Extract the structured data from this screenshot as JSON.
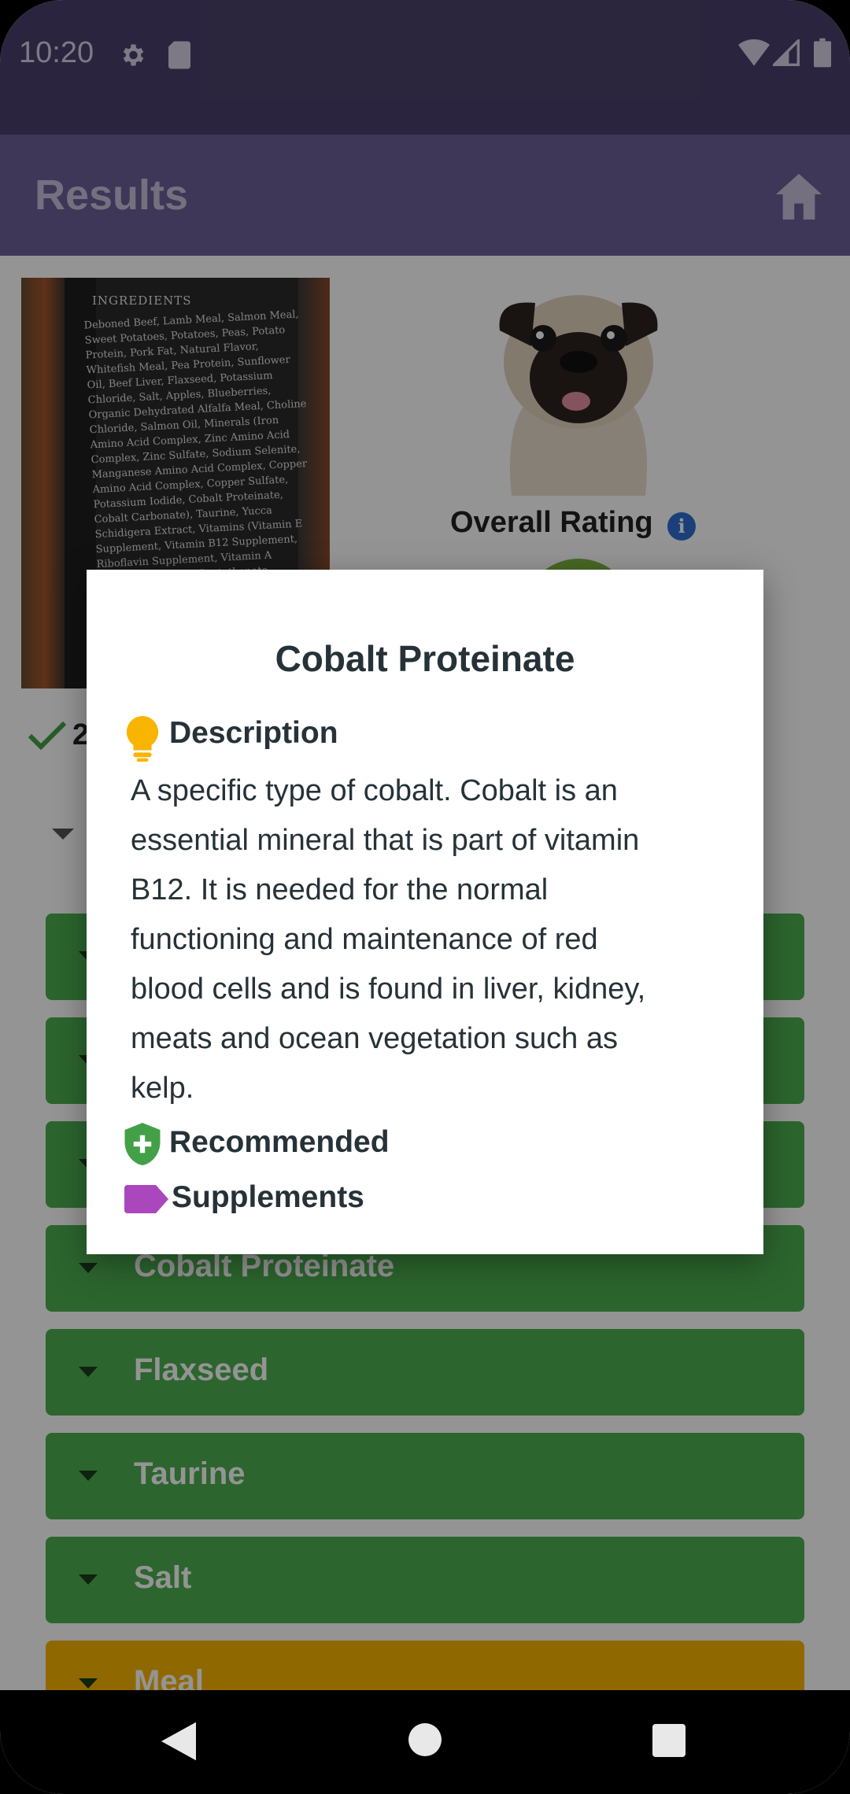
{
  "status_bar": {
    "time": "10:20",
    "icons": [
      "gear-icon",
      "sd-card-icon",
      "wifi-icon",
      "signal-icon",
      "battery-icon"
    ]
  },
  "app_bar": {
    "title": "Results",
    "home_icon": "home-icon"
  },
  "product": {
    "label_title": "INGREDIENTS",
    "label_text": "Deboned Beef, Lamb Meal, Salmon Meal, Sweet Potatoes, Potatoes, Peas, Potato Protein, Pork Fat, Natural Flavor, Whitefish Meal, Pea Protein, Sunflower Oil, Beef Liver, Flaxseed, Potassium Chloride, Salt, Apples, Blueberries, Organic Dehydrated Alfalfa Meal, Choline Chloride, Salmon Oil, Minerals (Iron Amino Acid Complex, Zinc Amino Acid Complex, Zinc Sulfate, Sodium Selenite, Manganese Amino Acid Complex, Copper Amino Acid Complex, Copper Sulfate, Potassium Iodide, Cobalt Proteinate, Cobalt Carbonate), Taurine, Yucca Schidigera Extract, Vitamins (Vitamin E Supplement, Vitamin B12 Supplement, Riboflavin Supplement, Vitamin A Acetate, d-Calcium Pantothenate, Thiamine Mononitrate, Folic Acid, Niacin, Biotin, Pyridoxine Hydrochloride, Vitamin D3 Supplement), Mixed Tocopherols for freshness, Citric",
    "overall_rating_label": "Overall Rating",
    "info_icon": "i",
    "checked_count": "2"
  },
  "ingredients": [
    {
      "label": "",
      "status": "good"
    },
    {
      "label": "",
      "status": "good"
    },
    {
      "label": "",
      "status": "good"
    },
    {
      "label": "Cobalt Proteinate",
      "status": "good"
    },
    {
      "label": "Flaxseed",
      "status": "good"
    },
    {
      "label": "Taurine",
      "status": "good"
    },
    {
      "label": "Salt",
      "status": "good"
    },
    {
      "label": "Meal",
      "status": "caution"
    }
  ],
  "dialog": {
    "title": "Cobalt Proteinate",
    "description_heading": "Description",
    "description_lines": [
      "A specific type of cobalt. Cobalt is an",
      "essential mineral that is part of vitamin",
      "B12. It is needed for the normal",
      "functioning and maintenance of red",
      "blood cells and is found in liver, kidney,",
      "meats and ocean vegetation such as",
      "kelp."
    ],
    "recommendation": "Recommended",
    "category": "Supplements"
  },
  "colors": {
    "status_bar": "#4a3f6b",
    "app_bar": "#6c5f96",
    "good": "#4caf50",
    "caution": "#f9b400",
    "bulb": "#f9b400",
    "shield": "#43a047",
    "tag": "#ab47bc"
  },
  "nav_bar": {
    "icons": [
      "back-icon",
      "home-circle-icon",
      "recents-icon"
    ]
  }
}
